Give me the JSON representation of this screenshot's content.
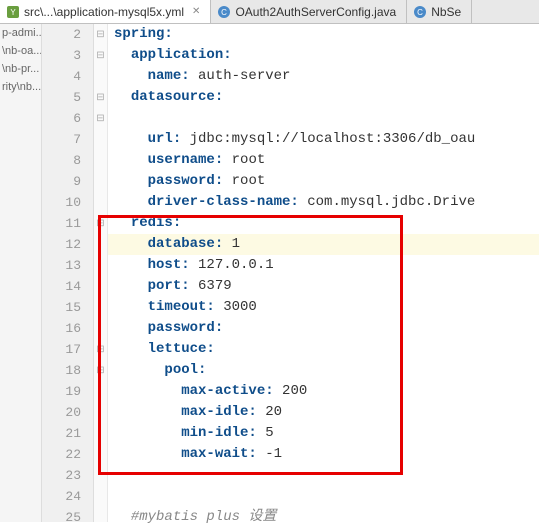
{
  "tabs": [
    {
      "label": "src\\...\\application-mysql5x.yml",
      "active": true
    },
    {
      "label": "OAuth2AuthServerConfig.java",
      "active": false
    },
    {
      "label": "NbSe",
      "active": false
    }
  ],
  "sidebar": {
    "items": [
      "p-admi...",
      "\\nb-oa...",
      "\\nb-pr...",
      "rity\\nb..."
    ]
  },
  "lines": [
    {
      "num": 2,
      "fold": "⊟",
      "indent": 0,
      "key": "spring:",
      "val": ""
    },
    {
      "num": 3,
      "fold": "⊟",
      "indent": 1,
      "key": "application:",
      "val": ""
    },
    {
      "num": 4,
      "fold": "",
      "indent": 2,
      "key": "name:",
      "val": " auth-server"
    },
    {
      "num": 5,
      "fold": "⊟",
      "indent": 1,
      "key": "datasource:",
      "val": ""
    },
    {
      "num": 6,
      "fold": "⊟",
      "indent": 1,
      "key": "",
      "val": ""
    },
    {
      "num": 7,
      "fold": "",
      "indent": 2,
      "key": "url:",
      "val": " jdbc:mysql://localhost:3306/db_oau"
    },
    {
      "num": 8,
      "fold": "",
      "indent": 2,
      "key": "username:",
      "val": " root"
    },
    {
      "num": 9,
      "fold": "",
      "indent": 2,
      "key": "password:",
      "val": " root"
    },
    {
      "num": 10,
      "fold": "",
      "indent": 2,
      "key": "driver-class-name:",
      "val": " com.mysql.jdbc.Drive"
    },
    {
      "num": 11,
      "fold": "⊟",
      "indent": 1,
      "key": "redis:",
      "val": ""
    },
    {
      "num": 12,
      "fold": "",
      "indent": 2,
      "key": "database:",
      "val": " 1",
      "current": true
    },
    {
      "num": 13,
      "fold": "",
      "indent": 2,
      "key": "host:",
      "val": " 127.0.0.1"
    },
    {
      "num": 14,
      "fold": "",
      "indent": 2,
      "key": "port:",
      "val": " 6379"
    },
    {
      "num": 15,
      "fold": "",
      "indent": 2,
      "key": "timeout:",
      "val": " 3000"
    },
    {
      "num": 16,
      "fold": "",
      "indent": 2,
      "key": "password:",
      "val": ""
    },
    {
      "num": 17,
      "fold": "⊟",
      "indent": 2,
      "key": "lettuce:",
      "val": ""
    },
    {
      "num": 18,
      "fold": "⊟",
      "indent": 3,
      "key": "pool:",
      "val": ""
    },
    {
      "num": 19,
      "fold": "",
      "indent": 4,
      "key": "max-active:",
      "val": " 200"
    },
    {
      "num": 20,
      "fold": "",
      "indent": 4,
      "key": "max-idle:",
      "val": " 20"
    },
    {
      "num": 21,
      "fold": "",
      "indent": 4,
      "key": "min-idle:",
      "val": " 5"
    },
    {
      "num": 22,
      "fold": "",
      "indent": 4,
      "key": "max-wait:",
      "val": " -1"
    },
    {
      "num": 23,
      "fold": "",
      "indent": 0,
      "key": "",
      "val": ""
    },
    {
      "num": 24,
      "fold": "",
      "indent": 0,
      "key": "",
      "val": ""
    },
    {
      "num": 25,
      "fold": "",
      "indent": 1,
      "key": "",
      "val": "",
      "comment": "#mybatis plus 设置"
    }
  ]
}
